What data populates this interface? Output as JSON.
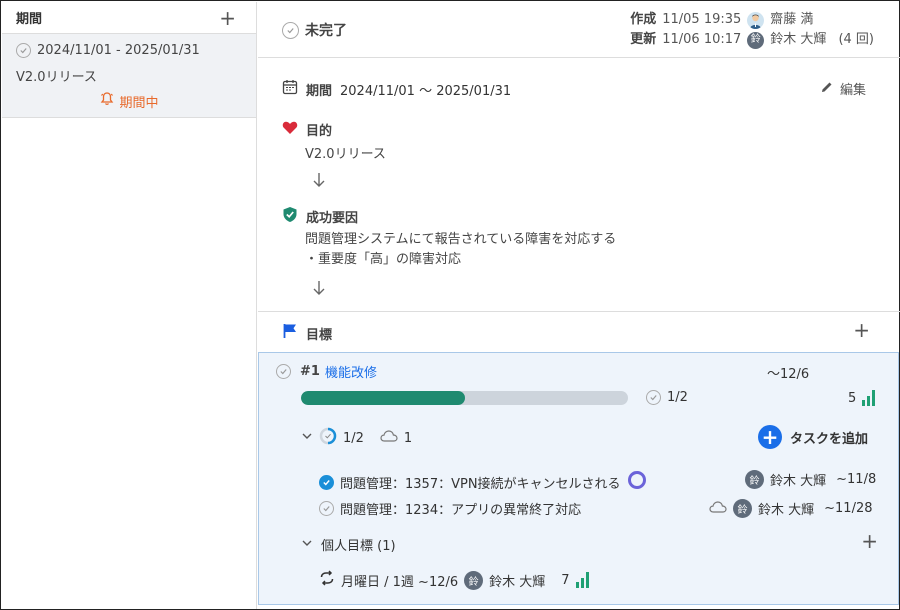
{
  "left": {
    "title": "期間",
    "period": {
      "range": "2024/11/01 - 2025/01/31",
      "name": "V2.0リリース",
      "status": "期間中"
    }
  },
  "topbar": {
    "status": "未完了",
    "created_label": "作成",
    "created_time": "11/05 19:35",
    "created_by": "齋藤 満",
    "updated_label": "更新",
    "updated_time": "11/06 10:17",
    "updated_by": "鈴木 大輝",
    "updated_count": "(4 回)"
  },
  "detail": {
    "period_label": "期間",
    "period_value": "2024/11/01 〜 2025/01/31",
    "edit_label": "編集",
    "purpose_label": "目的",
    "purpose_text": "V2.0リリース",
    "success_label": "成功要因",
    "success_line1": "問題管理システムにて報告されている障害を対応する",
    "success_line2": "・重要度「高」の障害対応"
  },
  "goals": {
    "title": "目標",
    "goal": {
      "number": "#1",
      "name": "機能改修",
      "due": "〜12/6",
      "progress": 0.5,
      "progress_text": "1/2",
      "score": "5",
      "tasks_count": "1/2",
      "cloud_count": "1",
      "add_task_label": "タスクを追加",
      "tasks": [
        {
          "title": "問題管理：1357：VPN接続がキャンセルされる",
          "assignee": "鈴木 大輝",
          "due": "~11/8",
          "done": true
        },
        {
          "title": "問題管理：1234：アプリの異常終了対応",
          "assignee": "鈴木 大輝",
          "due": "~11/28",
          "done": false
        }
      ],
      "personal_label": "個人目標 (1)",
      "personal": {
        "text": "月曜日 / 1週 ~12/6",
        "assignee": "鈴木 大輝",
        "score": "7"
      }
    }
  },
  "avatar_char": "鈴",
  "colors": {
    "accent": "#1a6ee8",
    "progress": "#1f8a70",
    "status_orange": "#e8692a",
    "heart": "#d92b3a",
    "shield": "#1f8a70",
    "flag": "#1a5ee0"
  }
}
